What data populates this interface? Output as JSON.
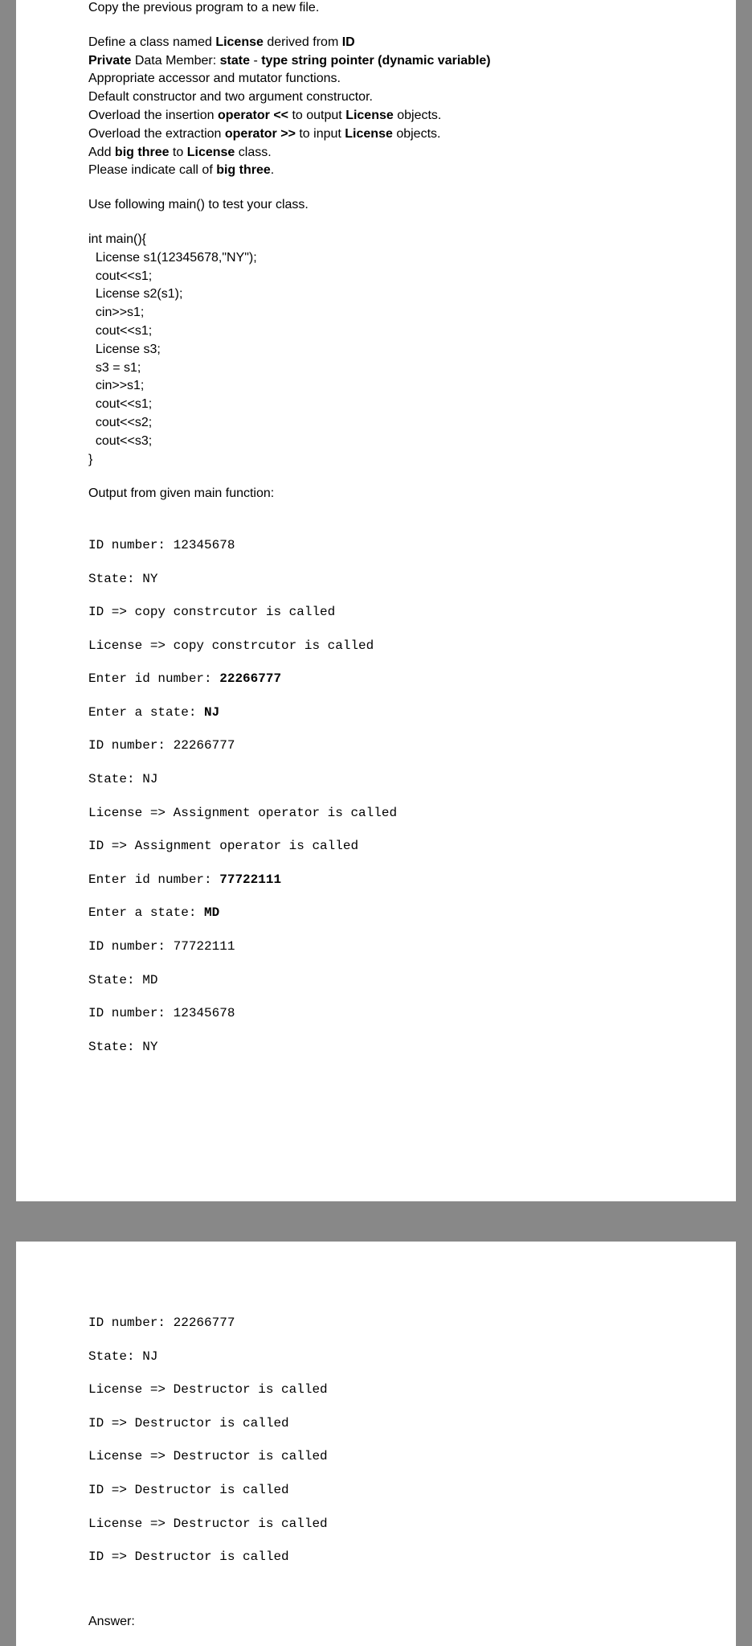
{
  "p1": {
    "copy": "Copy the previous program to a new file.",
    "l1_a": "Define a class named ",
    "l1_b": "License",
    "l1_c": " derived from ",
    "l1_d": "ID",
    "l2_a": "Private",
    "l2_b": " Data Member: ",
    "l2_c": "state",
    "l2_d": " - ",
    "l2_e": "type string pointer (dynamic variable)",
    "l3": "Appropriate accessor and mutator functions.",
    "l4": "Default constructor and two argument constructor.",
    "l5_a": "Overload the insertion ",
    "l5_b": "operator <<",
    "l5_c": " to output ",
    "l5_d": "License",
    "l5_e": " objects.",
    "l6_a": "Overload the extraction ",
    "l6_b": "operator >>",
    "l6_c": " to input ",
    "l6_d": "License",
    "l6_e": " objects.",
    "l7_a": "Add ",
    "l7_b": "big three",
    "l7_c": " to ",
    "l7_d": "License",
    "l7_e": " class.",
    "l8_a": "Please indicate call of ",
    "l8_b": "big three",
    "l8_c": "."
  },
  "use": "Use following main() to test your class.",
  "code": {
    "c1": "int main(){",
    "c2": "  License s1(12345678,\"NY\");",
    "c3": "  cout<<s1;",
    "c4": "  License s2(s1);",
    "c5": "  cin>>s1;",
    "c6": "  cout<<s1;",
    "c7": "  License s3;",
    "c8": "  s3 = s1;",
    "c9": "  cin>>s1;",
    "c10": "  cout<<s1;",
    "c11": "  cout<<s2;",
    "c12": "  cout<<s3;",
    "c13": "}"
  },
  "outlabel": "Output from given main function:",
  "out1": {
    "o1": "ID number: 12345678",
    "o2": "State: NY",
    "o3": "ID => copy constrcutor is called",
    "o4": "License => copy constrcutor is called",
    "o5a": "Enter id number: ",
    "o5b": "22266777",
    "o6a": "Enter a state: ",
    "o6b": "NJ",
    "o7": "ID number: 22266777",
    "o8": "State: NJ",
    "o9": "License => Assignment operator is called",
    "o10": "ID => Assignment operator is called",
    "o11a": "Enter id number: ",
    "o11b": "77722111",
    "o12a": "Enter a state: ",
    "o12b": "MD",
    "o13": "ID number: 77722111",
    "o14": "State: MD",
    "o15": "ID number: 12345678",
    "o16": "State: NY"
  },
  "out2": {
    "o1": "ID number: 22266777",
    "o2": "State: NJ",
    "o3": "License => Destructor is called",
    "o4": "ID => Destructor is called",
    "o5": "License => Destructor is called",
    "o6": "ID => Destructor is called",
    "o7": "License => Destructor is called",
    "o8": "ID => Destructor is called"
  },
  "answer": "Answer:"
}
